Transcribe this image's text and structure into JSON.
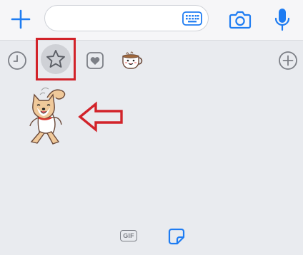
{
  "composer": {
    "message_value": "",
    "message_placeholder": ""
  },
  "icons": {
    "add": "plus-icon",
    "keyboard": "keyboard-icon",
    "camera": "camera-icon",
    "microphone": "microphone-icon",
    "recent": "clock-icon",
    "favorites": "star-icon",
    "liked": "heart-icon",
    "sticker_pack": "coffee-cup-sticker-icon",
    "add_pack": "plus-circle-icon",
    "gif": "gif-icon",
    "stickers": "sticker-icon"
  },
  "tray": {
    "selected_tab": "favorites",
    "stickers": [
      {
        "name": "shiba-dog-dancing-sticker"
      }
    ]
  },
  "bottom_tabs": {
    "gif_label": "GIF",
    "active": "stickers"
  },
  "annotation": {
    "highlight_color": "#d2232a",
    "arrow_direction": "left"
  },
  "colors": {
    "accent": "#1e7cf2",
    "icon_gray": "#7c7f86",
    "background": "#e9ebef",
    "annotation_red": "#d2232a"
  }
}
